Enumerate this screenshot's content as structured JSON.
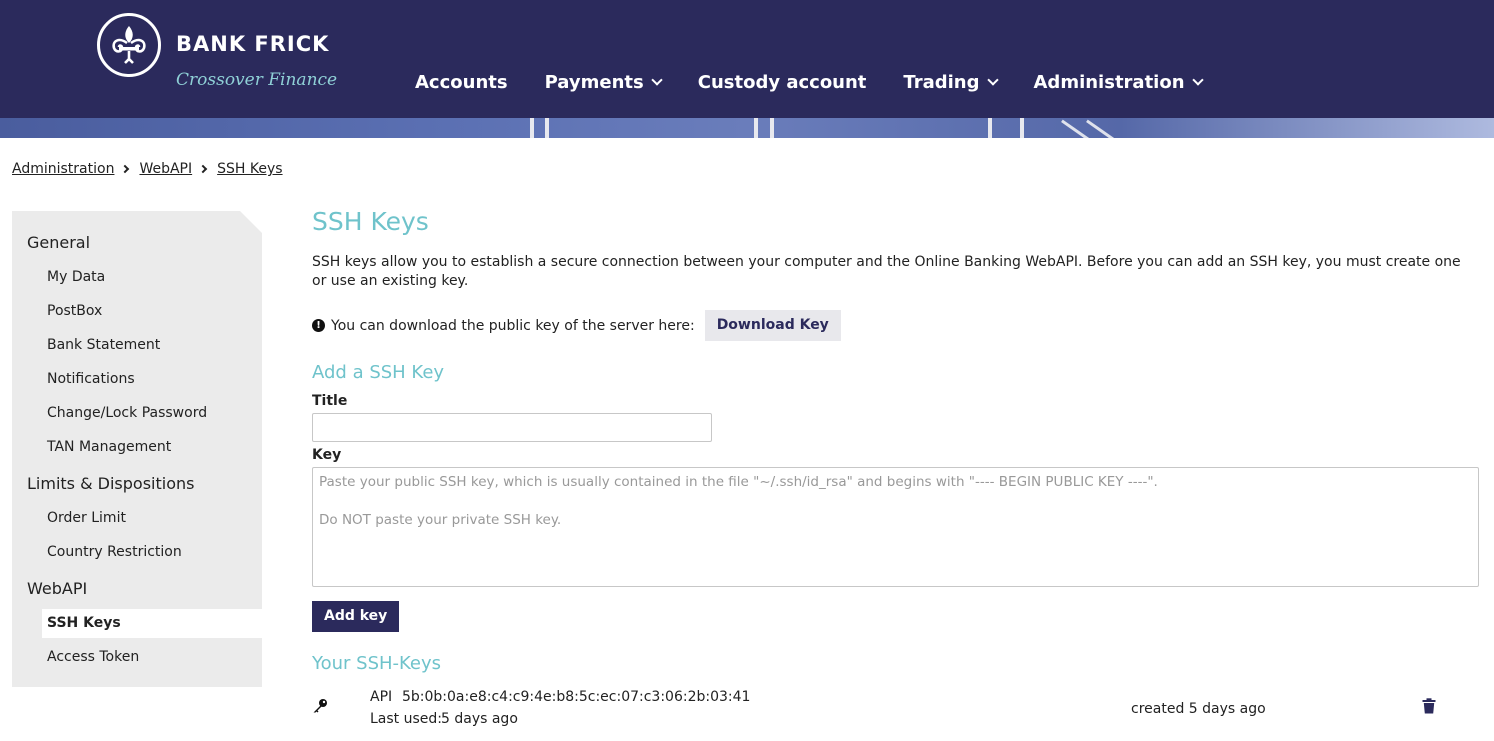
{
  "brand": {
    "name": "BANK FRICK",
    "tagline": "Crossover Finance"
  },
  "nav": {
    "items": [
      {
        "label": "Accounts",
        "has_dropdown": false
      },
      {
        "label": "Payments",
        "has_dropdown": true
      },
      {
        "label": "Custody account",
        "has_dropdown": false
      },
      {
        "label": "Trading",
        "has_dropdown": true
      },
      {
        "label": "Administration",
        "has_dropdown": true
      }
    ]
  },
  "breadcrumb": [
    "Administration",
    "WebAPI",
    "SSH Keys"
  ],
  "sidebar": {
    "groups": [
      {
        "label": "General",
        "items": [
          "My Data",
          "PostBox",
          "Bank Statement",
          "Notifications",
          "Change/Lock Password",
          "TAN Management"
        ]
      },
      {
        "label": "Limits & Dispositions",
        "items": [
          "Order Limit",
          "Country Restriction"
        ]
      },
      {
        "label": "WebAPI",
        "items": [
          "SSH Keys",
          "Access Token"
        ]
      }
    ],
    "active_item": "SSH Keys"
  },
  "main": {
    "title": "SSH Keys",
    "intro": "SSH keys allow you to establish a secure connection between your computer and the Online Banking WebAPI. Before you can add an SSH key, you must create one or use an existing key.",
    "download_info": "You can download the public key of the server here:",
    "download_button": "Download Key",
    "add_section_title": "Add a SSH Key",
    "title_label": "Title",
    "title_value": "",
    "key_label": "Key",
    "key_placeholder": "Paste your public SSH key, which is usually contained in the file \"~/.ssh/id_rsa\" and begins with \"---- BEGIN PUBLIC KEY ----\".\n\nDo NOT paste your private SSH key.",
    "add_button": "Add key",
    "your_keys_title": "Your SSH-Keys",
    "keys": [
      {
        "name": "API",
        "fingerprint": "5b:0b:0a:e8:c4:c9:4e:b8:5c:ec:07:c3:06:2b:03:41",
        "last_used_label": "Last used:",
        "last_used": "5 days ago",
        "created": "created 5 days ago"
      }
    ]
  },
  "colors": {
    "header_bg": "#2b2a5c",
    "accent_teal": "#6fc3cb",
    "sidebar_bg": "#ebebeb",
    "primary_button": "#2b2a5c"
  },
  "icons": {
    "logo": "fleur-de-lis-icon",
    "info": "info-circle-icon",
    "key": "key-icon",
    "delete": "trash-icon",
    "dropdown": "chevron-down-icon"
  }
}
